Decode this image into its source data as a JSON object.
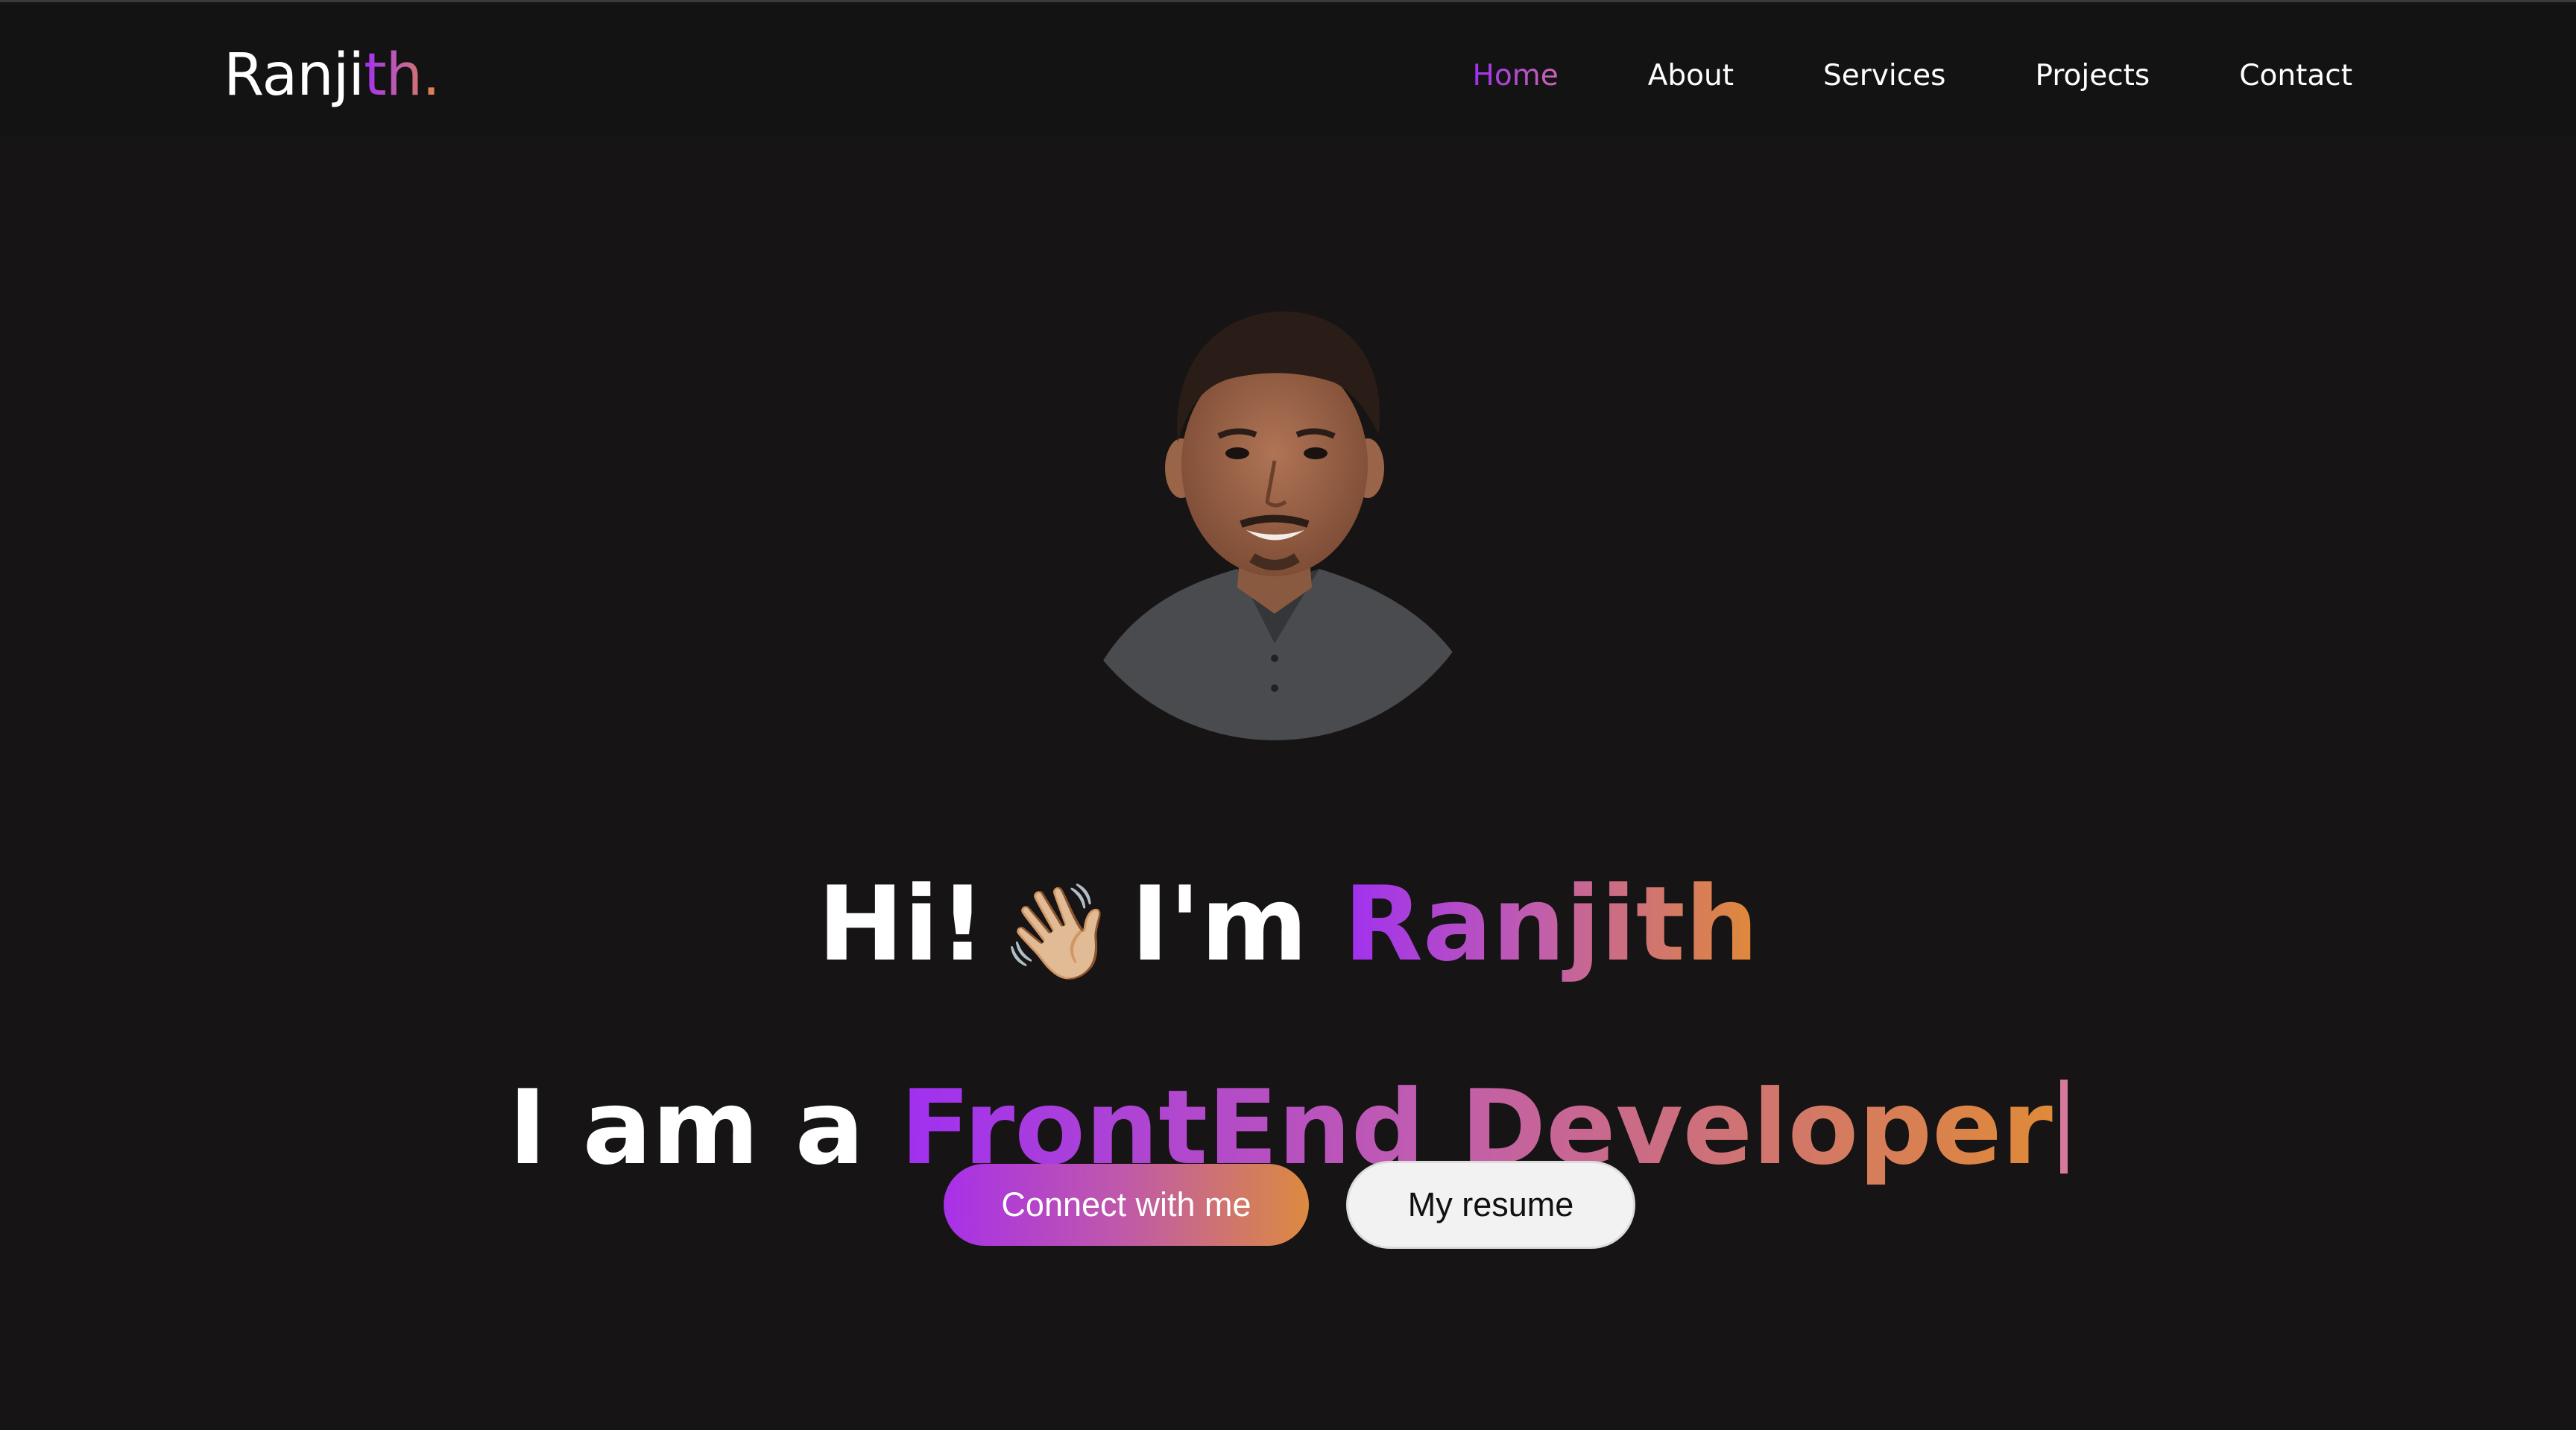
{
  "logo": {
    "main": "Ranji",
    "accent": "th."
  },
  "nav": {
    "items": [
      {
        "label": "Home",
        "active": true
      },
      {
        "label": "About",
        "active": false
      },
      {
        "label": "Services",
        "active": false
      },
      {
        "label": "Projects",
        "active": false
      },
      {
        "label": "Contact",
        "active": false
      }
    ]
  },
  "hero": {
    "greeting_prefix": "Hi!",
    "wave_emoji": "👋🏼",
    "greeting_im": "I'm",
    "name": "Ranjith",
    "tagline_prefix": "I am a",
    "role": "FrontEnd Developer",
    "avatar_icon": "profile-photo"
  },
  "buttons": {
    "connect_label": "Connect with me",
    "resume_label": "My resume"
  },
  "colors": {
    "background": "#161414",
    "gradient_start": "#a030f0",
    "gradient_mid": "#c05cb0",
    "gradient_end": "#df8a38",
    "text": "#ffffff"
  }
}
